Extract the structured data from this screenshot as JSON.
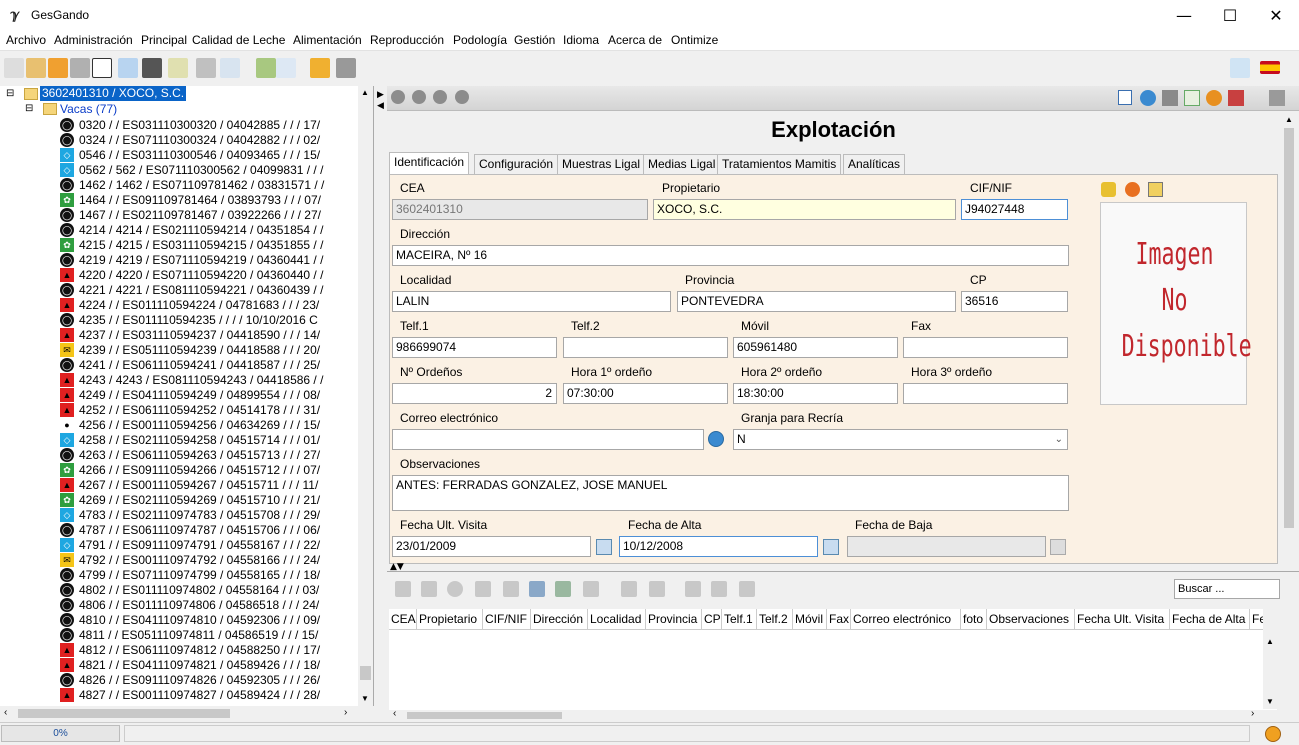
{
  "window": {
    "title": "GesGando",
    "minimize": "—",
    "maximize": "☐",
    "close": "✕"
  },
  "menu": [
    "Archivo",
    "Administración",
    "Principal",
    "Calidad de Leche",
    "Alimentación",
    "Reproducción",
    "Podología",
    "Gestión",
    "Idioma",
    "Acerca de",
    "Ontimize"
  ],
  "tree": {
    "root": "3602401310 / XOCO, S.C.",
    "folder": "Vacas (77)",
    "rows": [
      {
        "t": "0320 /  / ES031110300320 / 04042885 /  /  / 17/",
        "c": "black"
      },
      {
        "t": "0324 /  / ES071110300324 / 04042882 /  /  / 02/",
        "c": "black"
      },
      {
        "t": "0546 /  / ES031110300546 / 04093465 /  /  / 15/",
        "c": "blue"
      },
      {
        "t": "0562 / 562 / ES071110300562 / 04099831 /  /  /",
        "c": "blue"
      },
      {
        "t": "1462 / 1462 / ES071109781462 / 03831571 /  /",
        "c": "black"
      },
      {
        "t": "1464 /  / ES091109781464 / 03893793 /  /  / 07/",
        "c": "green"
      },
      {
        "t": "1467 /  / ES021109781467 / 03922266 /  /  / 27/",
        "c": "black"
      },
      {
        "t": "4214 / 4214 / ES021110594214 / 04351854 /  /",
        "c": "black"
      },
      {
        "t": "4215 / 4215 / ES031110594215 / 04351855 /  /",
        "c": "green"
      },
      {
        "t": "4219 / 4219 / ES071110594219 / 04360441 /  /",
        "c": "black"
      },
      {
        "t": "4220 / 4220 / ES071110594220 / 04360440 /  /",
        "c": "red"
      },
      {
        "t": "4221 / 4221 / ES081110594221 / 04360439 /  /",
        "c": "black"
      },
      {
        "t": "4224 /  / ES011110594224 / 04781683 /  /  / 23/",
        "c": "red"
      },
      {
        "t": "4235 /  / ES011110594235 /  /  /  / 10/10/2016 C",
        "c": "black"
      },
      {
        "t": "4237 /  / ES031110594237 / 04418590 /  /  / 14/",
        "c": "red"
      },
      {
        "t": "4239 /  / ES051110594239 / 04418588 /  /  / 20/",
        "c": "yellow"
      },
      {
        "t": "4241 /  / ES061110594241 / 04418587 /  /  / 25/",
        "c": "black"
      },
      {
        "t": "4243 / 4243 / ES081110594243 / 04418586 /  /",
        "c": "red"
      },
      {
        "t": "4249 /  / ES041110594249 / 04899554 /  /  / 08/",
        "c": "red"
      },
      {
        "t": "4252 /  / ES061110594252 / 04514178 /  /  / 31/",
        "c": "red"
      },
      {
        "t": "4256 /  / ES001110594256 / 04634269 /  /  / 15/",
        "c": "dark"
      },
      {
        "t": "4258 /  / ES021110594258 / 04515714 /  /  / 01/",
        "c": "blue"
      },
      {
        "t": "4263 /  / ES061110594263 / 04515713 /  /  / 27/",
        "c": "black"
      },
      {
        "t": "4266 /  / ES091110594266 / 04515712 /  /  / 07/",
        "c": "green"
      },
      {
        "t": "4267 /  / ES001110594267 / 04515711 /  /  / 11/",
        "c": "red"
      },
      {
        "t": "4269 /  / ES021110594269 / 04515710 /  /  / 21/",
        "c": "green"
      },
      {
        "t": "4783 /  / ES021110974783 / 04515708 /  /  / 29/",
        "c": "blue"
      },
      {
        "t": "4787 /  / ES061110974787 / 04515706 /  /  / 06/",
        "c": "black"
      },
      {
        "t": "4791 /  / ES091110974791 / 04558167 /  /  / 22/",
        "c": "blue"
      },
      {
        "t": "4792 /  / ES001110974792 / 04558166 /  /  / 24/",
        "c": "yellow"
      },
      {
        "t": "4799 /  / ES071110974799 / 04558165 /  /  / 18/",
        "c": "black"
      },
      {
        "t": "4802 /  / ES011110974802 / 04558164 /  /  / 03/",
        "c": "black"
      },
      {
        "t": "4806 /  / ES011110974806 / 04586518 /  /  / 24/",
        "c": "black"
      },
      {
        "t": "4810 /  / ES041110974810 / 04592306 /  /  / 09/",
        "c": "black"
      },
      {
        "t": "4811 /  / ES051110974811 / 04586519 /  /  / 15/",
        "c": "black"
      },
      {
        "t": "4812 /  / ES061110974812 / 04588250 /  /  / 17/",
        "c": "red"
      },
      {
        "t": "4821 /  / ES041110974821 / 04589426 /  /  / 18/",
        "c": "red"
      },
      {
        "t": "4826 /  / ES091110974826 / 04592305 /  /  / 26/",
        "c": "black"
      },
      {
        "t": "4827 /  / ES001110974827 / 04589424 /  /  / 28/",
        "c": "red"
      }
    ]
  },
  "form": {
    "title": "Explotación",
    "tabs": [
      "Identificación",
      "Configuración",
      "Muestras Ligal",
      "Medias Ligal",
      "Tratamientos Mamitis",
      "Analíticas"
    ],
    "labels": {
      "cea": "CEA",
      "propietario": "Propietario",
      "cif": "CIF/NIF",
      "direccion": "Dirección",
      "localidad": "Localidad",
      "provincia": "Provincia",
      "cp": "CP",
      "telf1": "Telf.1",
      "telf2": "Telf.2",
      "movil": "Móvil",
      "fax": "Fax",
      "ordenos": "Nº Ordeños",
      "hora1": "Hora 1º ordeño",
      "hora2": "Hora 2º ordeño",
      "hora3": "Hora 3º ordeño",
      "correo": "Correo electrónico",
      "granja": "Granja para Recría",
      "observaciones": "Observaciones",
      "fecha_visita": "Fecha Ult. Visita",
      "fecha_alta": "Fecha de Alta",
      "fecha_baja": "Fecha de Baja"
    },
    "values": {
      "cea": "3602401310",
      "propietario": "XOCO, S.C.",
      "cif": "J94027448",
      "direccion": "MACEIRA, Nº 16",
      "localidad": "LALIN",
      "provincia": "PONTEVEDRA",
      "cp": "36516",
      "telf1": "986699074",
      "telf2": "",
      "movil": "605961480",
      "fax": "",
      "ordenos": "2",
      "hora1": "07:30:00",
      "hora2": "18:30:00",
      "hora3": "",
      "correo": "",
      "granja": "N",
      "observaciones": "ANTES: FERRADAS GONZALEZ, JOSE MANUEL",
      "fecha_visita": "23/01/2009",
      "fecha_alta": "10/12/2008",
      "fecha_baja": ""
    },
    "image_text": [
      "Imagen",
      "No",
      "Disponible"
    ]
  },
  "grid": {
    "search_placeholder": "Buscar ...",
    "columns": [
      "CEA",
      "Propietario",
      "CIF/NIF",
      "Dirección",
      "Localidad",
      "Provincia",
      "CP",
      "Telf.1",
      "Telf.2",
      "Móvil",
      "Fax",
      "Correo electrónico",
      "foto",
      "Observaciones",
      "Fecha Ult. Visita",
      "Fecha de Alta",
      "Fe"
    ]
  },
  "status": {
    "progress_label": "0%",
    "progress": 0
  }
}
